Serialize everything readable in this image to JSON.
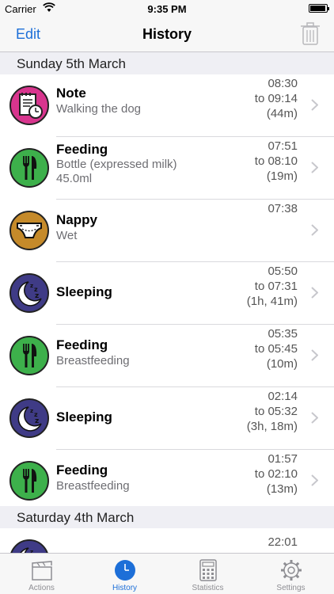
{
  "status": {
    "carrier": "Carrier",
    "time": "9:35 PM"
  },
  "nav": {
    "edit": "Edit",
    "title": "History"
  },
  "sections": [
    {
      "header": "Sunday 5th March",
      "rows": [
        {
          "type": "note",
          "title": "Note",
          "sub1": "Walking the dog",
          "sub2": "",
          "t1": "08:30",
          "t2": "to 09:14",
          "t3": "(44m)"
        },
        {
          "type": "feeding",
          "title": "Feeding",
          "sub1": "Bottle (expressed milk)",
          "sub2": "45.0ml",
          "t1": "07:51",
          "t2": "to 08:10",
          "t3": "(19m)"
        },
        {
          "type": "nappy",
          "title": "Nappy",
          "sub1": "Wet",
          "sub2": "",
          "t1": "07:38",
          "t2": "",
          "t3": ""
        },
        {
          "type": "sleeping",
          "title": "Sleeping",
          "sub1": "",
          "sub2": "",
          "t1": "05:50",
          "t2": "to 07:31",
          "t3": "(1h, 41m)"
        },
        {
          "type": "feeding",
          "title": "Feeding",
          "sub1": "Breastfeeding",
          "sub2": "",
          "t1": "05:35",
          "t2": "to 05:45",
          "t3": "(10m)"
        },
        {
          "type": "sleeping",
          "title": "Sleeping",
          "sub1": "",
          "sub2": "",
          "t1": "02:14",
          "t2": "to 05:32",
          "t3": "(3h, 18m)"
        },
        {
          "type": "feeding",
          "title": "Feeding",
          "sub1": "Breastfeeding",
          "sub2": "",
          "t1": "01:57",
          "t2": "to 02:10",
          "t3": "(13m)"
        }
      ]
    },
    {
      "header": "Saturday 4th March",
      "rows": [
        {
          "type": "sleeping",
          "title": "",
          "sub1": "",
          "sub2": "",
          "t1": "22:01",
          "t2": "",
          "t3": ""
        }
      ]
    }
  ],
  "tabs": [
    {
      "label": "Actions",
      "icon": "clapperboard-icon",
      "active": false
    },
    {
      "label": "History",
      "icon": "clock-icon",
      "active": true
    },
    {
      "label": "Statistics",
      "icon": "calculator-icon",
      "active": false
    },
    {
      "label": "Settings",
      "icon": "gear-icon",
      "active": false
    }
  ],
  "colors": {
    "accent": "#1d6fd8",
    "note": "#d8358e",
    "feeding": "#3db04b",
    "nappy": "#c58a2a",
    "sleeping": "#3f3b86"
  }
}
